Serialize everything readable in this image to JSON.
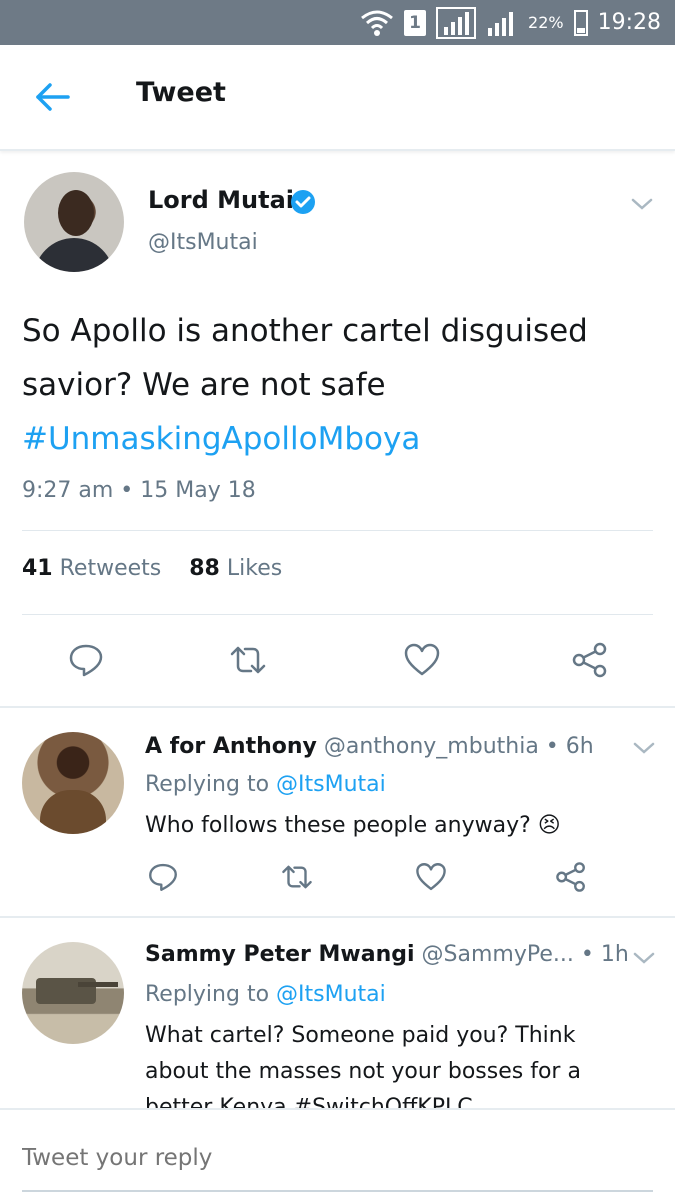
{
  "status_bar": {
    "sim_number": "1",
    "battery_percent": "22%",
    "time": "19:28"
  },
  "header": {
    "title": "Tweet"
  },
  "tweet": {
    "author_name": "Lord Mutai",
    "author_handle": "@ItsMutai",
    "text_line1": "So Apollo is another cartel disguised",
    "text_line2": "savior? We are not safe",
    "hashtag": "#UnmaskingApolloMboya",
    "timestamp": "9:27 am • 15 May 18",
    "retweets_count": "41",
    "retweets_label": "Retweets",
    "likes_count": "88",
    "likes_label": "Likes"
  },
  "replies": [
    {
      "name": "A for Anthony",
      "handle_time": "@anthony_mbuthia • 6h",
      "replying_prefix": "Replying to",
      "replying_to": "@ItsMutai",
      "text": "Who follows these people anyway? 😣"
    },
    {
      "name": "Sammy Peter Mwangi",
      "handle_time": "@SammyPe... • 1h",
      "replying_prefix": "Replying to",
      "replying_to": "@ItsMutai",
      "text_line1": "What cartel? Someone paid you? Think",
      "text_line2": "about the masses not your bosses for a",
      "text_line3": "better Kenya #SwitchOffKPLC"
    }
  ],
  "composer": {
    "placeholder": "Tweet your reply"
  },
  "colors": {
    "accent": "#1da1f2",
    "secondary_text": "#657786",
    "status_bar": "#6e7a86"
  }
}
